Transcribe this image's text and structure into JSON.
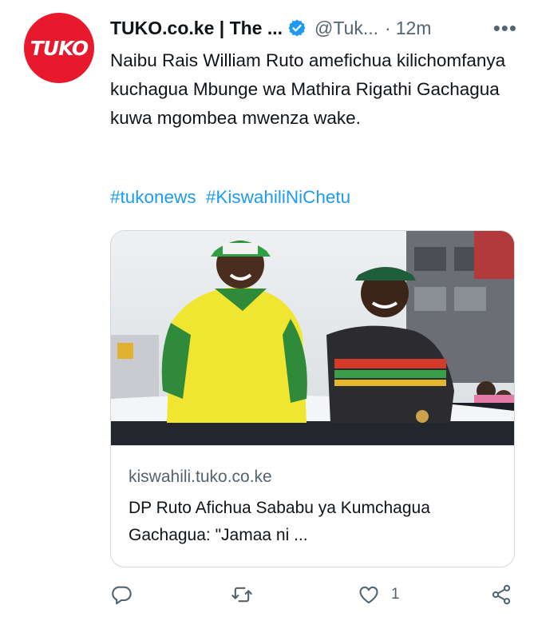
{
  "author": {
    "avatar_text": "TUKO",
    "display_name": "TUKO.co.ke | The ...",
    "handle": "@Tuk...",
    "separator": "·",
    "time": "12m",
    "more": "•••"
  },
  "tweet": {
    "text": "Naibu Rais William Ruto amefichua kilichomfanya kuchagua Mbunge wa Mathira Rigathi Gachagua kuwa mgombea mwenza wake.",
    "hashtags": [
      "#tukonews",
      "#KiswahiliNiChetu"
    ]
  },
  "card": {
    "domain": "kiswahili.tuko.co.ke",
    "title": "DP Ruto Afichua Sababu ya Kumchagua Gachagua: \"Jamaa ni ..."
  },
  "actions": {
    "like_count": "1"
  },
  "colors": {
    "brand": "#e8192c",
    "link": "#1d9bf0",
    "muted": "#536471",
    "verified": "#1d9bf0"
  },
  "icons": [
    "verified-badge-icon",
    "more-icon",
    "reply-icon",
    "retweet-icon",
    "like-icon",
    "share-icon"
  ]
}
